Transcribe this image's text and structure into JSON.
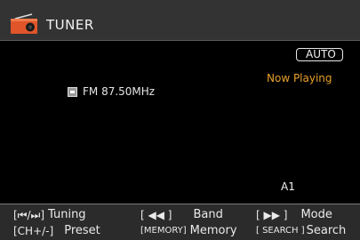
{
  "header": {
    "title": "TUNER",
    "icon": "radio-icon"
  },
  "main": {
    "auto_badge": "AUTO",
    "now_playing": "Now Playing",
    "station": "FM 87.50MHz",
    "preset": "A1"
  },
  "footer": {
    "row1": [
      {
        "key": "[⏮/⏭]",
        "label": "Tuning"
      },
      {
        "key": "[ ◀◀ ]",
        "label": "Band"
      },
      {
        "key": "[ ▶▶ ]",
        "label": "Mode"
      }
    ],
    "row2": [
      {
        "key": "[CH+/-]",
        "label": "Preset"
      },
      {
        "key": "[MEMORY]",
        "label": "Memory"
      },
      {
        "key": "[ SEARCH ]",
        "label": "Search"
      }
    ]
  },
  "colors": {
    "accent": "#e8a02a",
    "icon_red": "#e0552a"
  }
}
